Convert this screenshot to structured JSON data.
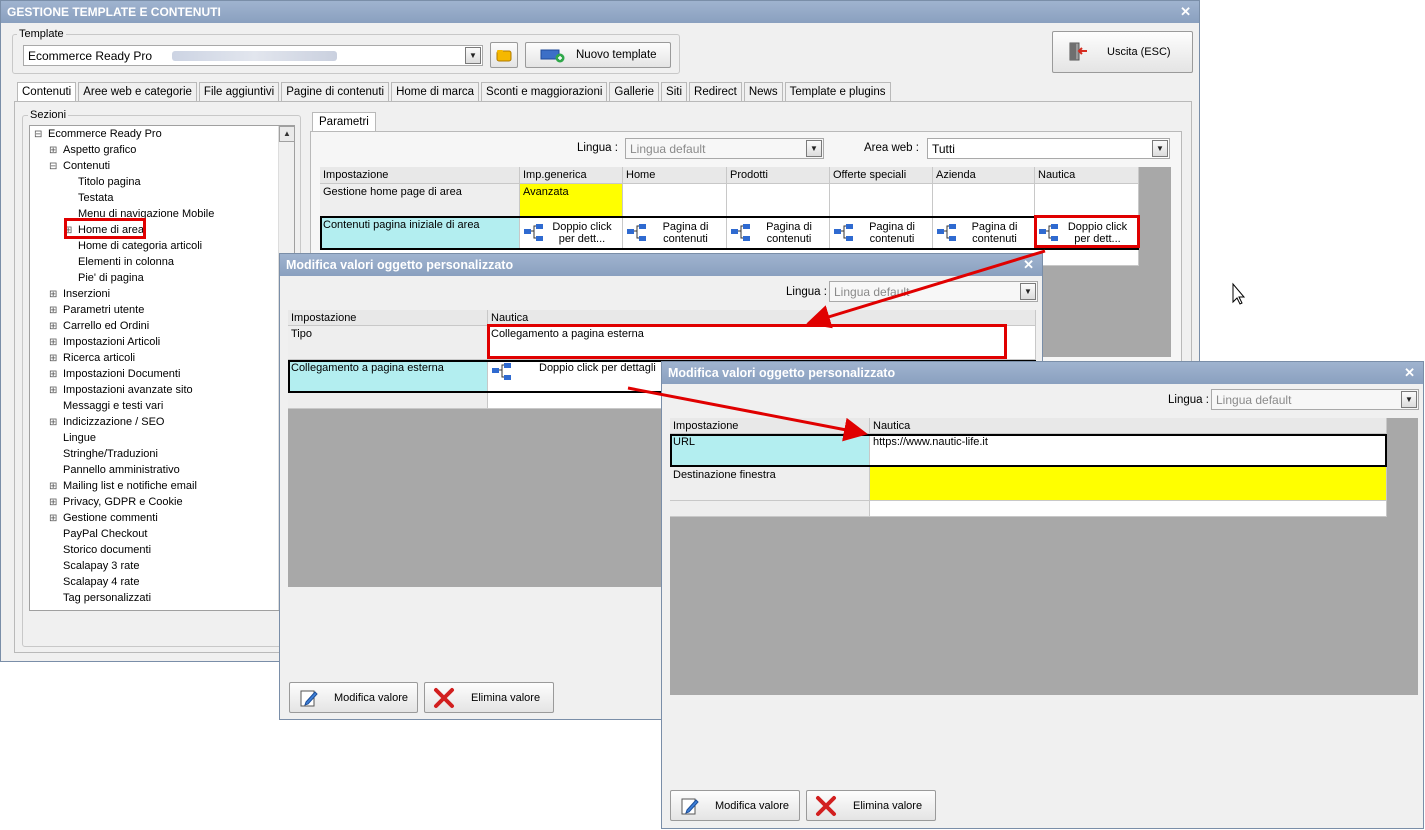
{
  "main": {
    "title": "GESTIONE TEMPLATE E CONTENUTI",
    "template_label": "Template",
    "template_value": "Ecommerce Ready Pro",
    "new_template_label": "Nuovo template",
    "exit_label": "Uscita (ESC)",
    "tabs": [
      "Contenuti",
      "Aree web e categorie",
      "File aggiuntivi",
      "Pagine di contenuti",
      "Home di marca",
      "Sconti e maggiorazioni",
      "Gallerie",
      "Siti",
      "Redirect",
      "News",
      "Template e plugins"
    ],
    "sections_label": "Sezioni",
    "params_tab": "Parametri",
    "lingua_label": "Lingua :",
    "lingua_value": "Lingua default",
    "area_label": "Area web :",
    "area_value": "Tutti",
    "tree": [
      {
        "label": "Ecommerce Ready Pro",
        "level": 0,
        "expander": "−"
      },
      {
        "label": "Aspetto grafico",
        "level": 1,
        "expander": "+"
      },
      {
        "label": "Contenuti",
        "level": 1,
        "expander": "−"
      },
      {
        "label": "Titolo pagina",
        "level": 2,
        "expander": ""
      },
      {
        "label": "Testata",
        "level": 2,
        "expander": ""
      },
      {
        "label": "Menu di navigazione Mobile",
        "level": 2,
        "expander": ""
      },
      {
        "label": "Home di area",
        "level": 2,
        "expander": "+"
      },
      {
        "label": "Home di categoria articoli",
        "level": 2,
        "expander": ""
      },
      {
        "label": "Elementi in colonna",
        "level": 2,
        "expander": ""
      },
      {
        "label": "Pie' di pagina",
        "level": 2,
        "expander": ""
      },
      {
        "label": "Inserzioni",
        "level": 1,
        "expander": "+"
      },
      {
        "label": "Parametri utente",
        "level": 1,
        "expander": "+"
      },
      {
        "label": "Carrello ed Ordini",
        "level": 1,
        "expander": "+"
      },
      {
        "label": "Impostazioni Articoli",
        "level": 1,
        "expander": "+"
      },
      {
        "label": "Ricerca articoli",
        "level": 1,
        "expander": "+"
      },
      {
        "label": "Impostazioni Documenti",
        "level": 1,
        "expander": "+"
      },
      {
        "label": "Impostazioni avanzate sito",
        "level": 1,
        "expander": "+"
      },
      {
        "label": "Messaggi e testi vari",
        "level": 1,
        "expander": ""
      },
      {
        "label": "Indicizzazione / SEO",
        "level": 1,
        "expander": "+"
      },
      {
        "label": "Lingue",
        "level": 1,
        "expander": ""
      },
      {
        "label": "Stringhe/Traduzioni",
        "level": 1,
        "expander": ""
      },
      {
        "label": "Pannello amministrativo",
        "level": 1,
        "expander": ""
      },
      {
        "label": "Mailing list e notifiche email",
        "level": 1,
        "expander": "+"
      },
      {
        "label": "Privacy, GDPR e Cookie",
        "level": 1,
        "expander": "+"
      },
      {
        "label": "Gestione commenti",
        "level": 1,
        "expander": "+"
      },
      {
        "label": "PayPal Checkout",
        "level": 1,
        "expander": ""
      },
      {
        "label": "Storico documenti",
        "level": 1,
        "expander": ""
      },
      {
        "label": "Scalapay 3 rate",
        "level": 1,
        "expander": ""
      },
      {
        "label": "Scalapay 4 rate",
        "level": 1,
        "expander": ""
      },
      {
        "label": "Tag personalizzati",
        "level": 1,
        "expander": ""
      }
    ],
    "grid": {
      "headers": [
        "Impostazione",
        "Imp.generica",
        "Home",
        "Prodotti",
        "Offerte speciali",
        "Azienda",
        "Nautica"
      ],
      "row1_label": "Gestione home page di area",
      "row1_value": "Avanzata",
      "row2_label": "Contenuti pagina iniziale di area",
      "row2_cells": [
        "Doppio click per dett...",
        "Pagina di contenuti",
        "Pagina di contenuti",
        "Pagina di contenuti",
        "Pagina di contenuti",
        "Doppio click per dett..."
      ]
    }
  },
  "dialog1": {
    "title": "Modifica valori oggetto personalizzato",
    "lingua_label": "Lingua :",
    "lingua_value": "Lingua default",
    "headers": [
      "Impostazione",
      "Nautica"
    ],
    "row1_label": "Tipo",
    "row1_value": "Collegamento a pagina esterna",
    "row2_label": "Collegamento a pagina esterna",
    "row2_value": "Doppio click per dettagli",
    "modify_label": "Modifica valore",
    "delete_label": "Elimina valore"
  },
  "dialog2": {
    "title": "Modifica valori oggetto personalizzato",
    "lingua_label": "Lingua :",
    "lingua_value": "Lingua default",
    "headers": [
      "Impostazione",
      "Nautica"
    ],
    "row1_label": "URL",
    "row1_value": "https://www.nautic-life.it",
    "row2_label": "Destinazione finestra",
    "row2_value": "",
    "modify_label": "Modifica valore",
    "delete_label": "Elimina valore"
  },
  "colors": {
    "title_bar": "#8aa0bf",
    "highlight_cyan": "#b3eef0",
    "highlight_yellow": "#ffff00",
    "annotation_red": "#e00000"
  },
  "icons": [
    "close-icon",
    "folder-icon",
    "add-template-icon",
    "exit-icon",
    "tree-link-icon",
    "pencil-icon",
    "red-x-icon",
    "mouse-cursor-icon"
  ]
}
